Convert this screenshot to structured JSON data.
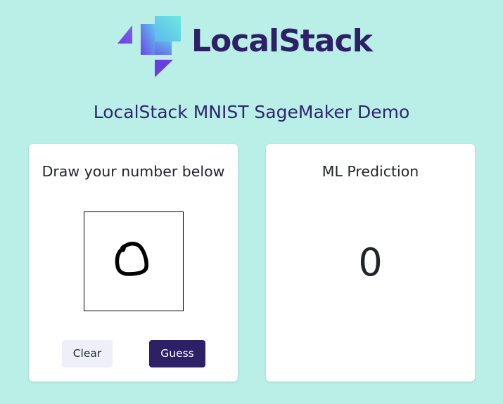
{
  "brand": {
    "name": "LocalStack",
    "logo_icon": "localstack-logo-icon",
    "colors": {
      "primary": "#2d2066",
      "gradient_start": "#7b3fe4",
      "gradient_end": "#5fd8e8"
    }
  },
  "page": {
    "title": "LocalStack MNIST SageMaker Demo",
    "background": "#b9efe6"
  },
  "draw_panel": {
    "title": "Draw your number below",
    "clear_label": "Clear",
    "guess_label": "Guess"
  },
  "prediction_panel": {
    "title": "ML Prediction",
    "value": "0"
  }
}
